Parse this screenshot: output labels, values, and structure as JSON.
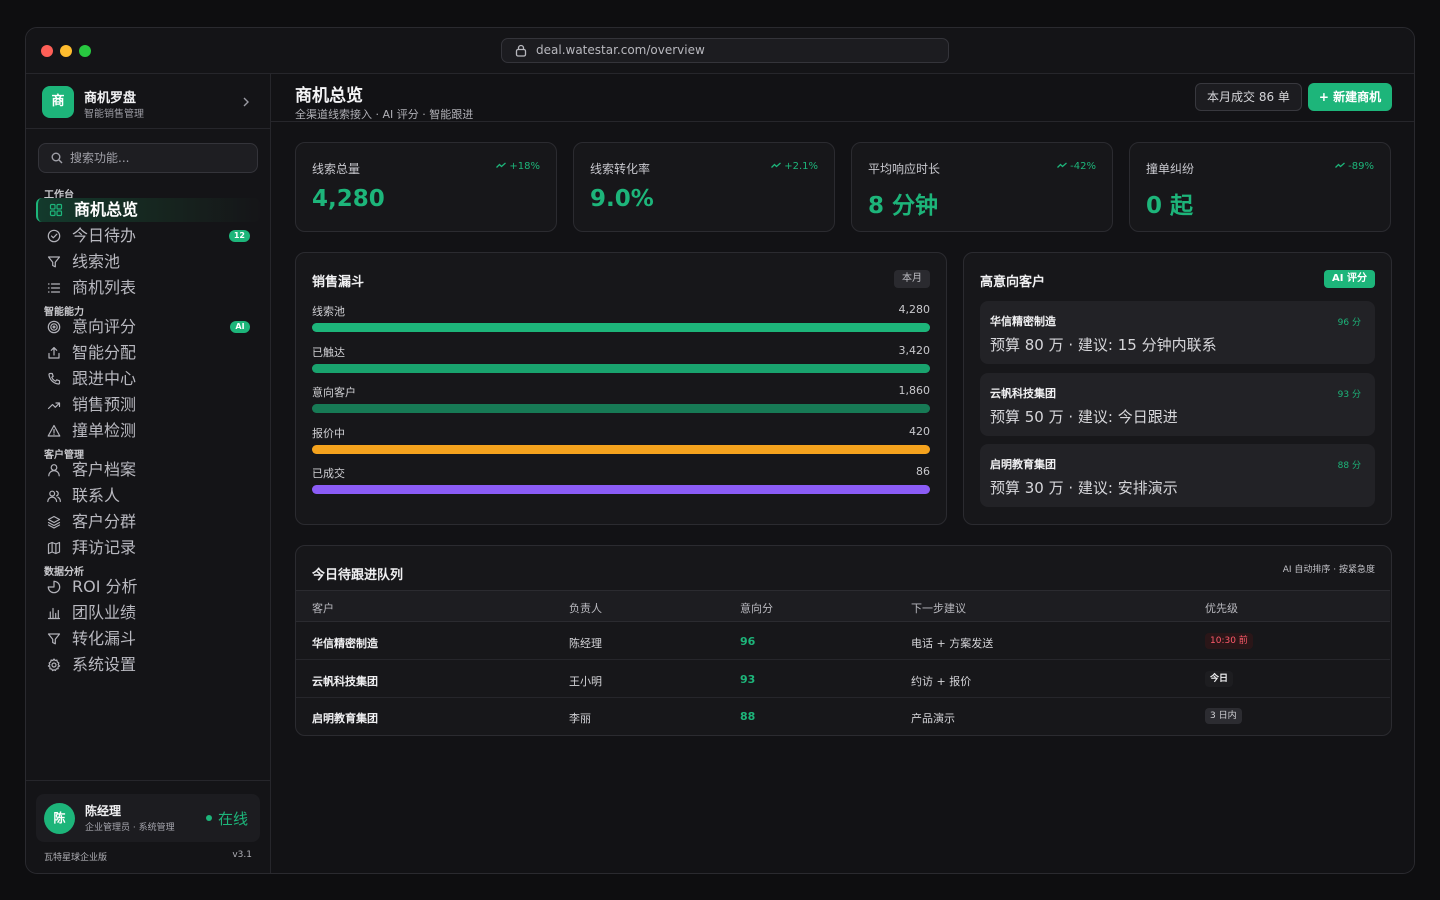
{
  "browser": {
    "url": "deal.watestar.com/overview"
  },
  "brand": {
    "logo": "商",
    "name": "商机罗盘",
    "subtitle": "智能销售管理"
  },
  "search": {
    "placeholder": "搜索功能..."
  },
  "nav_groups": [
    {
      "label": "工作台",
      "items": [
        {
          "label": "商机总览",
          "icon": "grid-icon",
          "active": true
        },
        {
          "label": "今日待办",
          "icon": "check-circle-icon",
          "badge": "12"
        },
        {
          "label": "线索池",
          "icon": "filter-icon"
        },
        {
          "label": "商机列表",
          "icon": "list-icon"
        }
      ]
    },
    {
      "label": "智能能力",
      "items": [
        {
          "label": "意向评分",
          "icon": "target-icon",
          "badge": "AI"
        },
        {
          "label": "智能分配",
          "icon": "share-icon"
        },
        {
          "label": "跟进中心",
          "icon": "phone-icon"
        },
        {
          "label": "销售预测",
          "icon": "trend-icon"
        },
        {
          "label": "撞单检测",
          "icon": "alert-icon"
        }
      ]
    },
    {
      "label": "客户管理",
      "items": [
        {
          "label": "客户档案",
          "icon": "user-icon"
        },
        {
          "label": "联系人",
          "icon": "users-icon"
        },
        {
          "label": "客户分群",
          "icon": "layers-icon"
        },
        {
          "label": "拜访记录",
          "icon": "map-icon"
        }
      ]
    },
    {
      "label": "数据分析",
      "items": [
        {
          "label": "ROI 分析",
          "icon": "pie-icon"
        },
        {
          "label": "团队业绩",
          "icon": "bar-chart-icon"
        },
        {
          "label": "转化漏斗",
          "icon": "funnel-icon"
        },
        {
          "label": "系统设置",
          "icon": "gear-icon"
        }
      ]
    }
  ],
  "user": {
    "avatar": "陈",
    "name": "陈经理",
    "role": "企业管理员 · 系统管理",
    "status": "在线"
  },
  "footer": {
    "edition": "瓦特星球企业版",
    "version": "v3.1"
  },
  "header": {
    "title": "商机总览",
    "subtitle": "全渠道线索接入 · AI 评分 · 智能跟进",
    "deals_button": "本月成交 86 单",
    "new_button": "+ 新建商机"
  },
  "kpis": [
    {
      "label": "线索总量",
      "value": "4,280",
      "delta": "+18%"
    },
    {
      "label": "线索转化率",
      "value": "9.0%",
      "delta": "+2.1%"
    },
    {
      "label": "平均响应时长",
      "value": "8 分钟",
      "delta": "-42%"
    },
    {
      "label": "撞单纠纷",
      "value": "0 起",
      "delta": "-89%"
    }
  ],
  "funnel": {
    "title": "销售漏斗",
    "period": "本月",
    "stages": [
      {
        "label": "线索池",
        "value": "4,280",
        "fill": 1.0,
        "color": "#1db57a"
      },
      {
        "label": "已触达",
        "value": "3,420",
        "fill": 1.0,
        "color": "#19a36e"
      },
      {
        "label": "意向客户",
        "value": "1,860",
        "fill": 1.0,
        "color": "#177a55"
      },
      {
        "label": "报价中",
        "value": "420",
        "fill": 1.0,
        "color": "#f4a21d"
      },
      {
        "label": "已成交",
        "value": "86",
        "fill": 1.0,
        "color": "#8b5cf6"
      }
    ]
  },
  "leads": {
    "title": "高意向客户",
    "tag": "AI 评分",
    "items": [
      {
        "name": "华信精密制造",
        "score": "96 分",
        "desc": "预算 80 万 · 建议: 15 分钟内联系"
      },
      {
        "name": "云帆科技集团",
        "score": "93 分",
        "desc": "预算 50 万 · 建议: 今日跟进"
      },
      {
        "name": "启明教育集团",
        "score": "88 分",
        "desc": "预算 30 万 · 建议: 安排演示"
      }
    ]
  },
  "queue": {
    "title": "今日待跟进队列",
    "meta": "AI 自动排序 · 按紧急度",
    "columns": [
      "客户",
      "负责人",
      "意向分",
      "下一步建议",
      "优先级"
    ],
    "rows": [
      {
        "customer": "华信精密制造",
        "owner": "陈经理",
        "score": "96",
        "next": "电话 + 方案发送",
        "priority": "10:30 前",
        "priority_style": "red"
      },
      {
        "customer": "云帆科技集团",
        "owner": "王小明",
        "score": "93",
        "next": "约访 + 报价",
        "priority": "今日",
        "priority_style": "dark"
      },
      {
        "customer": "启明教育集团",
        "owner": "李丽",
        "score": "88",
        "next": "产品演示",
        "priority": "3 日内",
        "priority_style": "grey"
      }
    ]
  }
}
